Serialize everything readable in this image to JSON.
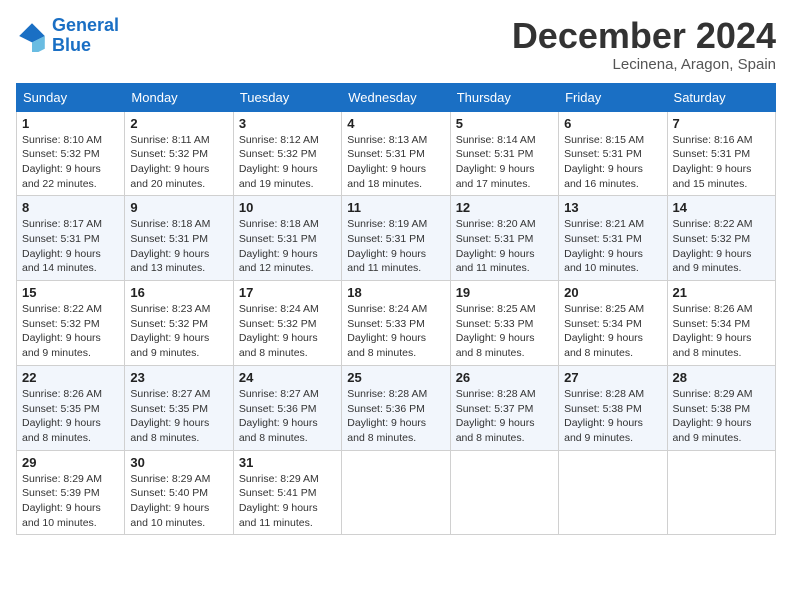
{
  "header": {
    "logo_line1": "General",
    "logo_line2": "Blue",
    "month": "December 2024",
    "location": "Lecinena, Aragon, Spain"
  },
  "days_of_week": [
    "Sunday",
    "Monday",
    "Tuesday",
    "Wednesday",
    "Thursday",
    "Friday",
    "Saturday"
  ],
  "weeks": [
    [
      {
        "day": "1",
        "info": "Sunrise: 8:10 AM\nSunset: 5:32 PM\nDaylight: 9 hours\nand 22 minutes."
      },
      {
        "day": "2",
        "info": "Sunrise: 8:11 AM\nSunset: 5:32 PM\nDaylight: 9 hours\nand 20 minutes."
      },
      {
        "day": "3",
        "info": "Sunrise: 8:12 AM\nSunset: 5:32 PM\nDaylight: 9 hours\nand 19 minutes."
      },
      {
        "day": "4",
        "info": "Sunrise: 8:13 AM\nSunset: 5:31 PM\nDaylight: 9 hours\nand 18 minutes."
      },
      {
        "day": "5",
        "info": "Sunrise: 8:14 AM\nSunset: 5:31 PM\nDaylight: 9 hours\nand 17 minutes."
      },
      {
        "day": "6",
        "info": "Sunrise: 8:15 AM\nSunset: 5:31 PM\nDaylight: 9 hours\nand 16 minutes."
      },
      {
        "day": "7",
        "info": "Sunrise: 8:16 AM\nSunset: 5:31 PM\nDaylight: 9 hours\nand 15 minutes."
      }
    ],
    [
      {
        "day": "8",
        "info": "Sunrise: 8:17 AM\nSunset: 5:31 PM\nDaylight: 9 hours\nand 14 minutes."
      },
      {
        "day": "9",
        "info": "Sunrise: 8:18 AM\nSunset: 5:31 PM\nDaylight: 9 hours\nand 13 minutes."
      },
      {
        "day": "10",
        "info": "Sunrise: 8:18 AM\nSunset: 5:31 PM\nDaylight: 9 hours\nand 12 minutes."
      },
      {
        "day": "11",
        "info": "Sunrise: 8:19 AM\nSunset: 5:31 PM\nDaylight: 9 hours\nand 11 minutes."
      },
      {
        "day": "12",
        "info": "Sunrise: 8:20 AM\nSunset: 5:31 PM\nDaylight: 9 hours\nand 11 minutes."
      },
      {
        "day": "13",
        "info": "Sunrise: 8:21 AM\nSunset: 5:31 PM\nDaylight: 9 hours\nand 10 minutes."
      },
      {
        "day": "14",
        "info": "Sunrise: 8:22 AM\nSunset: 5:32 PM\nDaylight: 9 hours\nand 9 minutes."
      }
    ],
    [
      {
        "day": "15",
        "info": "Sunrise: 8:22 AM\nSunset: 5:32 PM\nDaylight: 9 hours\nand 9 minutes."
      },
      {
        "day": "16",
        "info": "Sunrise: 8:23 AM\nSunset: 5:32 PM\nDaylight: 9 hours\nand 9 minutes."
      },
      {
        "day": "17",
        "info": "Sunrise: 8:24 AM\nSunset: 5:32 PM\nDaylight: 9 hours\nand 8 minutes."
      },
      {
        "day": "18",
        "info": "Sunrise: 8:24 AM\nSunset: 5:33 PM\nDaylight: 9 hours\nand 8 minutes."
      },
      {
        "day": "19",
        "info": "Sunrise: 8:25 AM\nSunset: 5:33 PM\nDaylight: 9 hours\nand 8 minutes."
      },
      {
        "day": "20",
        "info": "Sunrise: 8:25 AM\nSunset: 5:34 PM\nDaylight: 9 hours\nand 8 minutes."
      },
      {
        "day": "21",
        "info": "Sunrise: 8:26 AM\nSunset: 5:34 PM\nDaylight: 9 hours\nand 8 minutes."
      }
    ],
    [
      {
        "day": "22",
        "info": "Sunrise: 8:26 AM\nSunset: 5:35 PM\nDaylight: 9 hours\nand 8 minutes."
      },
      {
        "day": "23",
        "info": "Sunrise: 8:27 AM\nSunset: 5:35 PM\nDaylight: 9 hours\nand 8 minutes."
      },
      {
        "day": "24",
        "info": "Sunrise: 8:27 AM\nSunset: 5:36 PM\nDaylight: 9 hours\nand 8 minutes."
      },
      {
        "day": "25",
        "info": "Sunrise: 8:28 AM\nSunset: 5:36 PM\nDaylight: 9 hours\nand 8 minutes."
      },
      {
        "day": "26",
        "info": "Sunrise: 8:28 AM\nSunset: 5:37 PM\nDaylight: 9 hours\nand 8 minutes."
      },
      {
        "day": "27",
        "info": "Sunrise: 8:28 AM\nSunset: 5:38 PM\nDaylight: 9 hours\nand 9 minutes."
      },
      {
        "day": "28",
        "info": "Sunrise: 8:29 AM\nSunset: 5:38 PM\nDaylight: 9 hours\nand 9 minutes."
      }
    ],
    [
      {
        "day": "29",
        "info": "Sunrise: 8:29 AM\nSunset: 5:39 PM\nDaylight: 9 hours\nand 10 minutes."
      },
      {
        "day": "30",
        "info": "Sunrise: 8:29 AM\nSunset: 5:40 PM\nDaylight: 9 hours\nand 10 minutes."
      },
      {
        "day": "31",
        "info": "Sunrise: 8:29 AM\nSunset: 5:41 PM\nDaylight: 9 hours\nand 11 minutes."
      },
      null,
      null,
      null,
      null
    ]
  ]
}
